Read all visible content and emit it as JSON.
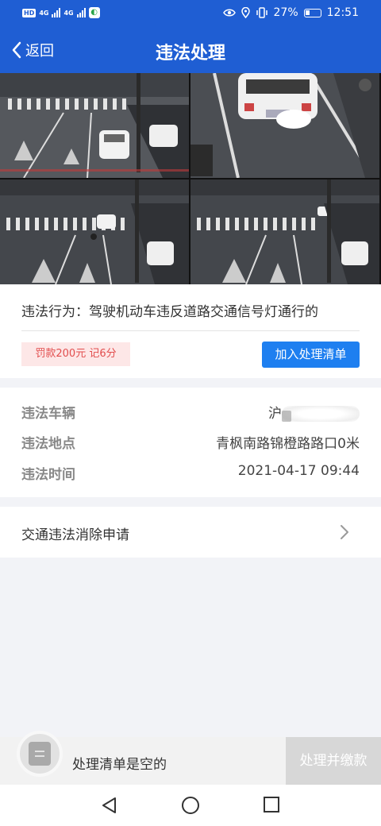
{
  "status_bar": {
    "left_chip": "HD",
    "network_1": "4G",
    "network_2": "4G",
    "battery": "27%",
    "time": "12:51"
  },
  "nav": {
    "back_label": "返回",
    "title": "违法处理"
  },
  "photos": {
    "count": 4
  },
  "violation": {
    "text": "违法行为：驾驶机动车违反道路交通信号灯通行的",
    "penalty": "罚款200元 记6分",
    "add_button": "加入处理清单"
  },
  "details": {
    "vehicle_label": "违法车辆",
    "vehicle_value": "沪",
    "location_label": "违法地点",
    "location_value": "青枫南路锦橙路路口0米",
    "time_label": "违法时间",
    "time_value": "2021-04-17 09:44"
  },
  "appeal": {
    "label": "交通违法消除申请"
  },
  "bottom": {
    "empty_text": "处理清单是空的",
    "pay_button": "处理并缴款"
  },
  "colors": {
    "header": "#1f5ed3",
    "accent_button": "#1e7ff0",
    "penalty_bg": "#fde7e7",
    "penalty_text": "#e24d4d"
  }
}
